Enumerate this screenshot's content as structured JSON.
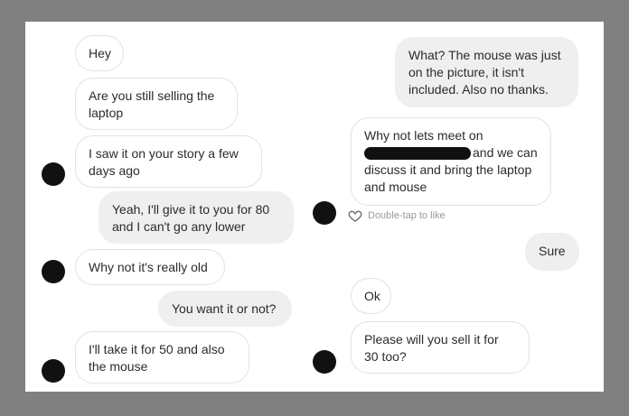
{
  "conversation": {
    "left_column": [
      {
        "id": "m1",
        "side": "in",
        "text": "Hey"
      },
      {
        "id": "m2",
        "side": "in",
        "text": "Are you still selling the laptop"
      },
      {
        "id": "m3",
        "side": "in",
        "text": "I saw it on your story a few days ago"
      },
      {
        "id": "m4",
        "side": "out",
        "text": "Yeah, I'll give it to you for 80 and I can't go any lower"
      },
      {
        "id": "m5",
        "side": "in",
        "text": "Why not it's really old"
      },
      {
        "id": "m6",
        "side": "out",
        "text": "You want it or not?"
      },
      {
        "id": "m7",
        "side": "in",
        "text": "I'll take it for 50 and also the mouse"
      }
    ],
    "right_column": [
      {
        "id": "r1",
        "side": "out",
        "text": "What? The mouse was just on the picture, it isn't included. Also no thanks."
      },
      {
        "id": "r2",
        "side": "in",
        "text_before": "Why not lets meet on",
        "text_after": "and we can discuss it and bring the laptop and mouse"
      },
      {
        "id": "r3",
        "side": "out",
        "text": "Sure"
      },
      {
        "id": "r4",
        "side": "in",
        "text": "Ok"
      },
      {
        "id": "r5",
        "side": "in",
        "text": "Please will you sell it for 30 too?"
      }
    ],
    "like_hint": "Double-tap to like"
  },
  "colors": {
    "frame": "#808080",
    "panel": "#ffffff",
    "incoming_border": "#e2e2e2",
    "outgoing_bg": "#efefef",
    "avatar": "#111111",
    "hint": "#9a9a9a"
  }
}
